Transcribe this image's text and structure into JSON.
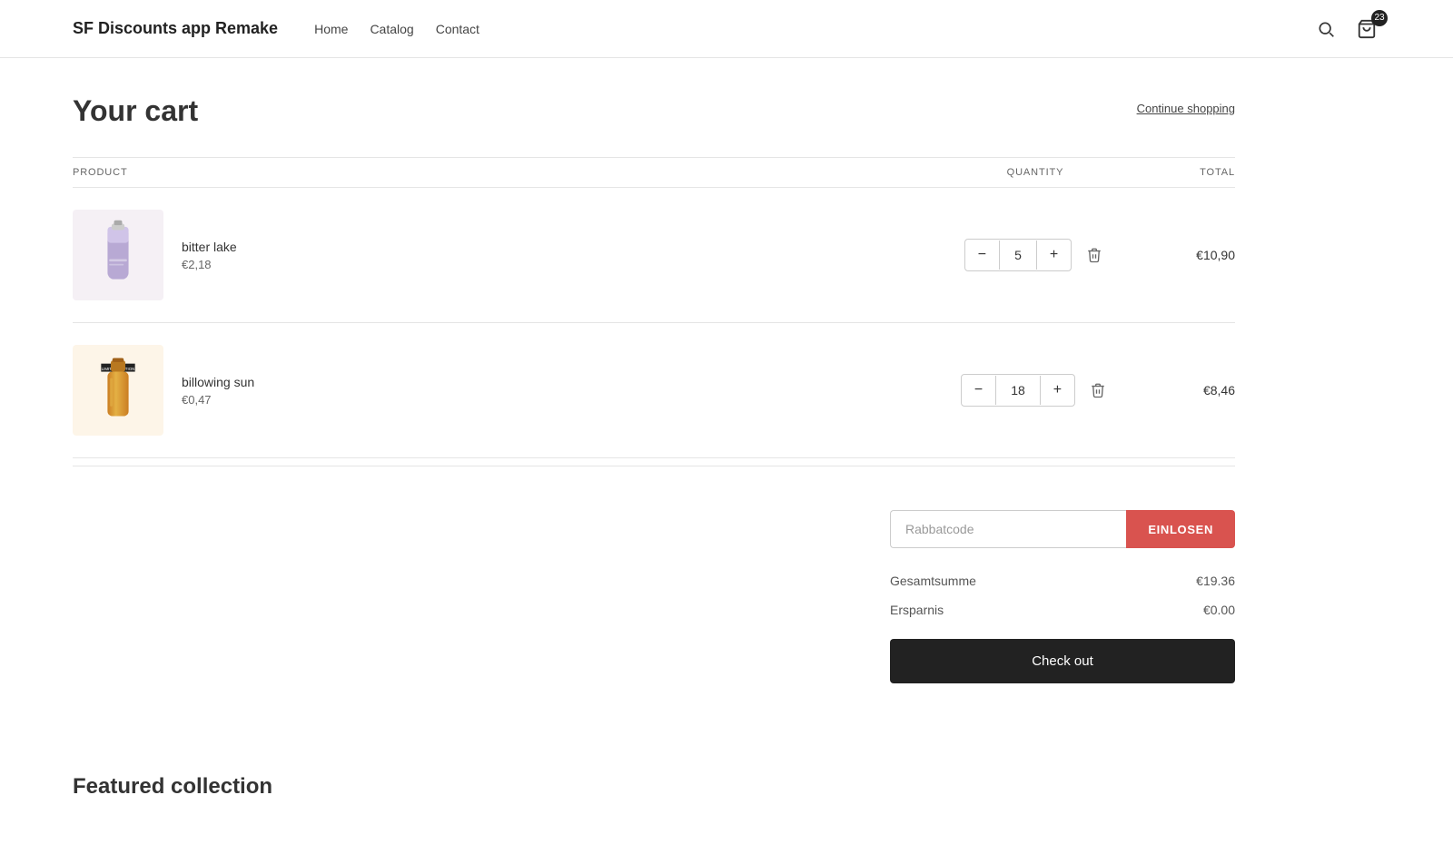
{
  "site": {
    "title": "SF Discounts app Remake"
  },
  "nav": {
    "items": [
      {
        "label": "Home",
        "id": "home"
      },
      {
        "label": "Catalog",
        "id": "catalog"
      },
      {
        "label": "Contact",
        "id": "contact"
      }
    ]
  },
  "header": {
    "cart_count": "23",
    "continue_shopping": "Continue shopping"
  },
  "cart": {
    "title": "Your cart",
    "columns": {
      "product": "PRODUCT",
      "quantity": "QUANTITY",
      "total": "TOTAL"
    },
    "items": [
      {
        "id": "bitter-lake",
        "name": "bitter lake",
        "price": "€2,18",
        "quantity": 5,
        "total": "€10,90",
        "image_style": "bitter-lake"
      },
      {
        "id": "billowing-sun",
        "name": "billowing sun",
        "price": "€0,47",
        "quantity": 18,
        "total": "€8,46",
        "image_style": "billowing-sun"
      }
    ]
  },
  "summary": {
    "discount_placeholder": "Rabbatcode",
    "einlosen_label": "EINLOSEN",
    "gesamtsumme_label": "Gesamtsumme",
    "gesamtsumme_value": "€19.36",
    "ersparnis_label": "Ersparnis",
    "ersparnis_value": "€0.00",
    "checkout_label": "Check out"
  },
  "featured": {
    "title": "Featured collection"
  }
}
